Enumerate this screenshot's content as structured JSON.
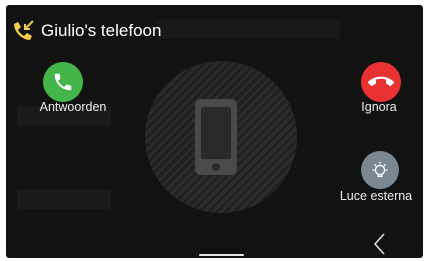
{
  "header": {
    "title": "Giulio's telefoon",
    "icon": "phone-incoming-icon"
  },
  "actions": {
    "answer_label": "Antwoorden",
    "ignore_label": "Ignora",
    "light_label": "Luce esterna"
  },
  "colors": {
    "answer": "#43b549",
    "decline": "#e83232",
    "light": "#7a8894",
    "header_icon": "#f2c94c"
  },
  "nav": {
    "back_icon": "chevron-left-icon"
  }
}
